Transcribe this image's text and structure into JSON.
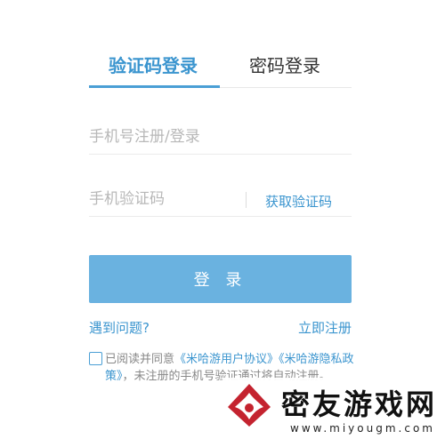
{
  "tabs": {
    "sms": "验证码登录",
    "password": "密码登录"
  },
  "form": {
    "phone_placeholder": "手机号注册/登录",
    "code_placeholder": "手机验证码",
    "get_code": "获取验证码",
    "login_button": "登 录"
  },
  "links": {
    "help": "遇到问题?",
    "register": "立即注册"
  },
  "agreement": {
    "prefix": "已阅读并同意",
    "user_agreement": "《米哈游用户协议》",
    "privacy_policy": "《米哈游隐私政策》",
    "suffix": "，未注册的手机号验证通过将自动注册。"
  },
  "watermark": {
    "title": "密友游戏网",
    "url": "www.miyougm.com"
  },
  "colors": {
    "accent": "#3b95cf",
    "button": "#6ab2e0",
    "logo": "#c4232f"
  }
}
